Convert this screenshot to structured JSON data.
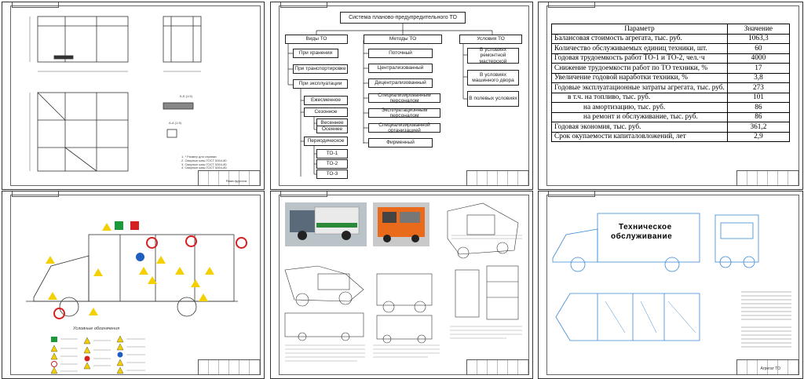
{
  "sheet2": {
    "title": "Система планово-предупредительного ТО",
    "col1": {
      "head": "Виды ТО",
      "items": [
        "При хранении",
        "При транспортировке",
        "При эксплуатации"
      ],
      "sub": [
        "Ежесменное",
        "Сезонное",
        "Весеннее",
        "Осеннее",
        "Периодическое",
        "ТО-1",
        "ТО-2",
        "ТО-3"
      ]
    },
    "col2": {
      "head": "Методы ТО",
      "items": [
        "Поточный",
        "Централизованный",
        "Децентрализованный",
        "Специализированным персоналом",
        "Эксплуатационным персоналом",
        "Специализированной организацией",
        "Фирменный"
      ]
    },
    "col3": {
      "head": "Условия ТО",
      "items": [
        "В условиях ремонтной мастерской",
        "В условиях машинного двора",
        "В полевых условиях"
      ]
    }
  },
  "sheet3": {
    "headers": [
      "Параметр",
      "Значение"
    ],
    "rows": [
      {
        "label": "Балансовая стоимость агрегата, тыс. руб.",
        "value": "1063,3"
      },
      {
        "label": "Количество обслуживаемых единиц техники, шт.",
        "value": "60"
      },
      {
        "label": "Годовая трудоемкость работ ТО-1 и ТО-2, чел.·ч",
        "value": "4000"
      },
      {
        "label": "Снижение трудоемкости работ по ТО техники, %",
        "value": "17"
      },
      {
        "label": "Увеличение годовой наработки техники, %",
        "value": "3,8"
      },
      {
        "label": "Годовые эксплуатационные затраты агрегата, тыс. руб.",
        "value": "273"
      },
      {
        "label": "в т.ч. на топливо, тыс. руб.",
        "value": "101"
      },
      {
        "label": "на амортизацию, тыс. руб.",
        "value": "86"
      },
      {
        "label": "на ремонт и обслуживание, тыс. руб.",
        "value": "86"
      },
      {
        "label": "Годовая экономия, тыс. руб.",
        "value": "361,2"
      },
      {
        "label": "Срок окупаемости капиталовложений, лет",
        "value": "2,9"
      }
    ]
  },
  "sheet4": {
    "legend_title": "Условные обозначения"
  },
  "sheet6": {
    "truck_label_1": "Техническое",
    "truck_label_2": "обслуживание",
    "stamp_name": "Агрегат ТО"
  },
  "sheet1": {
    "stamp_name": "Рама фургона"
  },
  "colors": {
    "sign_yellow": "#f5d000",
    "sign_red": "#d42020",
    "sign_green": "#1a9a3a",
    "sign_blue": "#1f5fbf",
    "truck_orange": "#e86a1a",
    "truck_blue_line": "#3a8ad6"
  }
}
